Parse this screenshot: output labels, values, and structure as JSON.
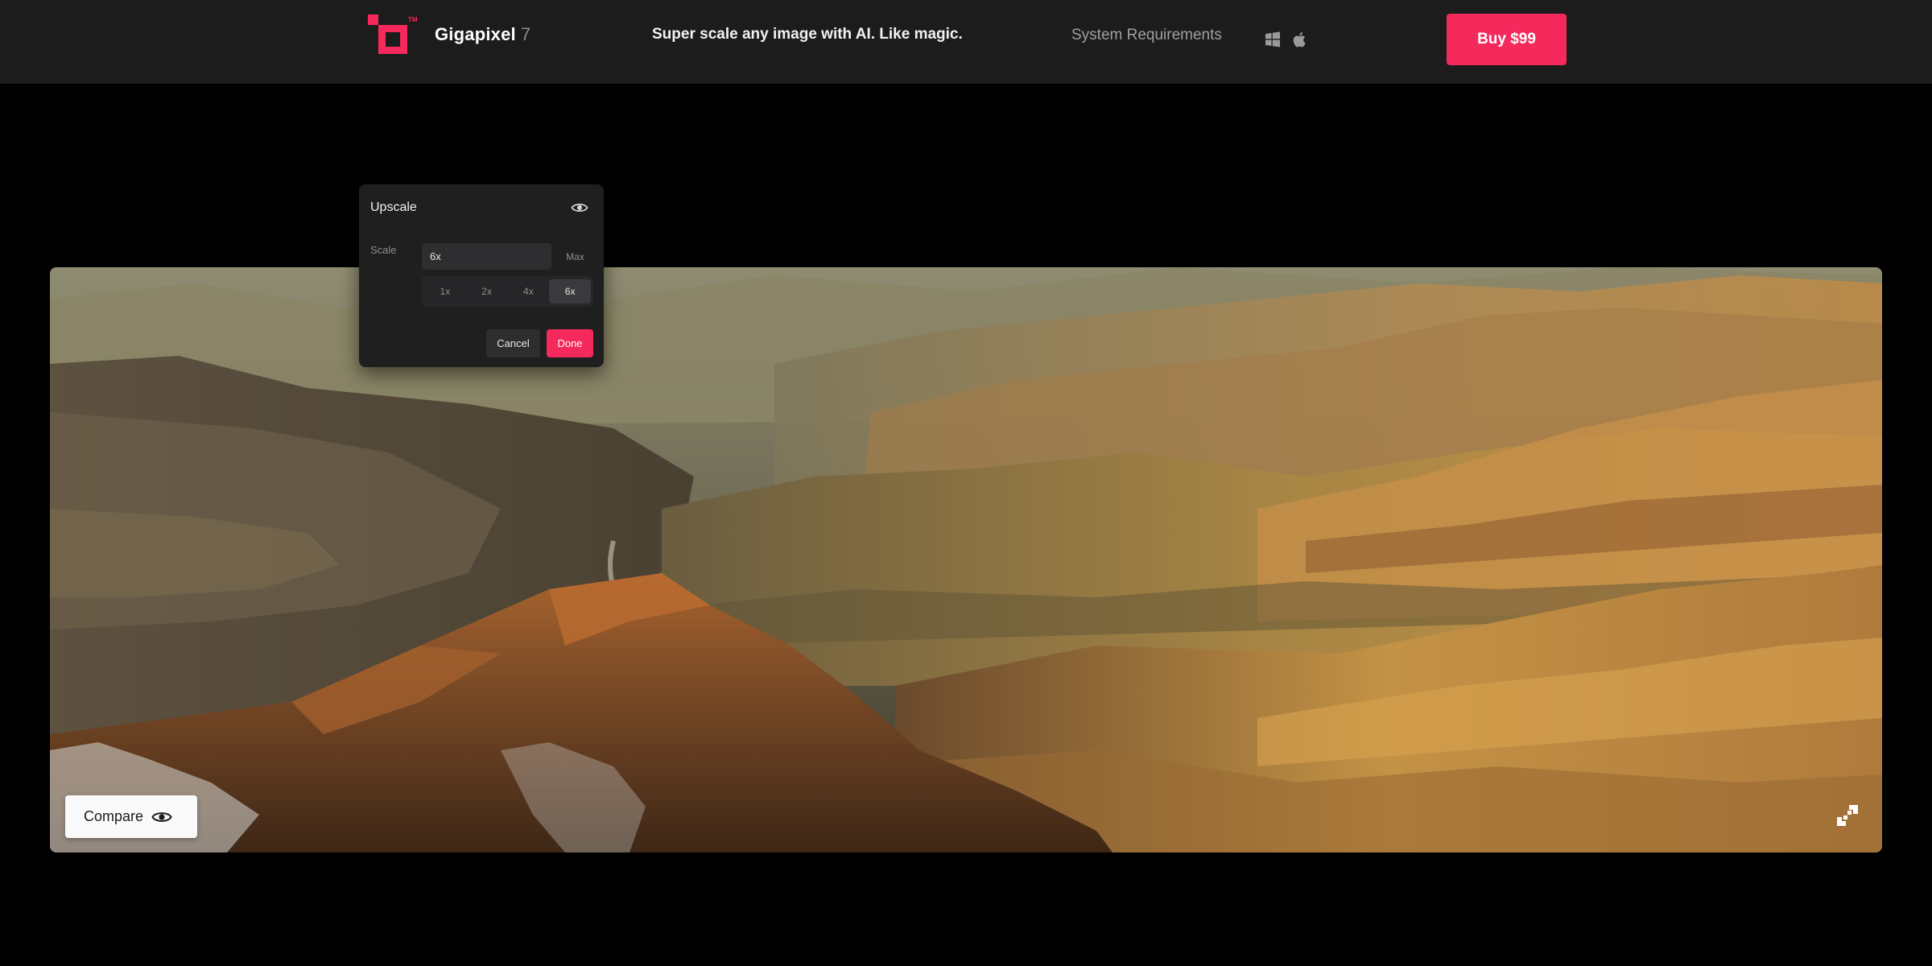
{
  "header": {
    "brand": "Gigapixel",
    "version": "7",
    "trademark": "TM",
    "tagline": "Super scale any image with AI. Like magic.",
    "system_requirements": "System Requirements",
    "buy_label": "Buy  $99",
    "os_icons": [
      "windows-icon",
      "apple-icon"
    ]
  },
  "panel": {
    "title": "Upscale",
    "scale_label": "Scale",
    "scale_value": "6x",
    "max_label": "Max",
    "options": [
      "1x",
      "2x",
      "4x",
      "6x"
    ],
    "selected_option": "6x",
    "cancel_label": "Cancel",
    "done_label": "Done"
  },
  "viewer": {
    "compare_label": "Compare",
    "image_subject": "canyon landscape"
  },
  "colors": {
    "accent": "#f5295b",
    "header_bg": "#1c1c1c",
    "panel_bg": "#1f1f20"
  }
}
